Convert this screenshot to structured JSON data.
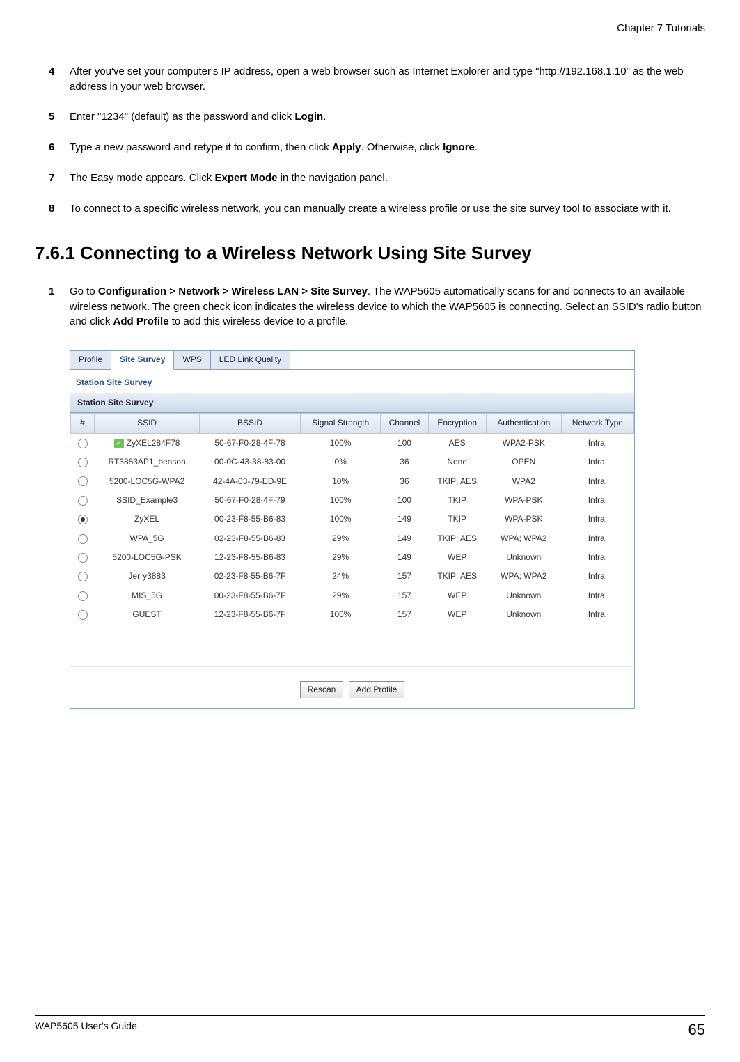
{
  "header_right": "Chapter 7 Tutorials",
  "steps_a": [
    {
      "num": "4",
      "html": "After you've set your computer's IP address, open a web browser such as Internet Explorer and type \"http://192.168.1.10\" as the web address in your web browser."
    },
    {
      "num": "5",
      "html": "Enter \"1234\" (default) as the password and click <b>Login</b>."
    },
    {
      "num": "6",
      "html": "Type a new password and retype it to confirm, then click <b>Apply</b>. Otherwise, click <b>Ignore</b>."
    },
    {
      "num": "7",
      "html": "The Easy mode appears. Click <b>Expert Mode</b> in the navigation panel."
    },
    {
      "num": "8",
      "html": "To connect to a specific wireless network, you can manually create a wireless profile or use the site survey tool to associate with it."
    }
  ],
  "section_heading": "7.6.1  Connecting to a Wireless Network Using Site Survey",
  "steps_b": [
    {
      "num": "1",
      "html": "Go to <b>Configuration > Network > Wireless LAN > Site Survey</b>. The WAP5605 automatically scans for and connects to an available wireless network. The green check icon indicates the wireless device to which the WAP5605 is connecting. Select an SSID's radio button and click <b>Add Profile</b> to add this wireless device to a profile."
    }
  ],
  "ui": {
    "tabs": [
      "Profile",
      "Site Survey",
      "WPS",
      "LED Link Quality"
    ],
    "active_tab_index": 1,
    "section_title": "Station Site Survey",
    "panel_head": "Station Site Survey",
    "columns": [
      "#",
      "SSID",
      "BSSID",
      "Signal Strength",
      "Channel",
      "Encryption",
      "Authentication",
      "Network Type"
    ],
    "rows": [
      {
        "selected": false,
        "connected": true,
        "ssid": "ZyXEL284F78",
        "bssid": "50-67-F0-28-4F-78",
        "signal": "100%",
        "channel": "100",
        "enc": "AES",
        "auth": "WPA2-PSK",
        "ntype": "Infra."
      },
      {
        "selected": false,
        "connected": false,
        "ssid": "RT3883AP1_benson",
        "bssid": "00-0C-43-38-83-00",
        "signal": "0%",
        "channel": "36",
        "enc": "None",
        "auth": "OPEN",
        "ntype": "Infra."
      },
      {
        "selected": false,
        "connected": false,
        "ssid": "5200-LOC5G-WPA2",
        "bssid": "42-4A-03-79-ED-9E",
        "signal": "10%",
        "channel": "36",
        "enc": "TKIP; AES",
        "auth": "WPA2",
        "ntype": "Infra."
      },
      {
        "selected": false,
        "connected": false,
        "ssid": "SSID_Example3",
        "bssid": "50-67-F0-28-4F-79",
        "signal": "100%",
        "channel": "100",
        "enc": "TKIP",
        "auth": "WPA-PSK",
        "ntype": "Infra."
      },
      {
        "selected": true,
        "connected": false,
        "ssid": "ZyXEL",
        "bssid": "00-23-F8-55-B6-83",
        "signal": "100%",
        "channel": "149",
        "enc": "TKIP",
        "auth": "WPA-PSK",
        "ntype": "Infra."
      },
      {
        "selected": false,
        "connected": false,
        "ssid": "WPA_5G",
        "bssid": "02-23-F8-55-B6-83",
        "signal": "29%",
        "channel": "149",
        "enc": "TKIP; AES",
        "auth": "WPA; WPA2",
        "ntype": "Infra."
      },
      {
        "selected": false,
        "connected": false,
        "ssid": "5200-LOC5G-PSK",
        "bssid": "12-23-F8-55-B6-83",
        "signal": "29%",
        "channel": "149",
        "enc": "WEP",
        "auth": "Unknown",
        "ntype": "Infra."
      },
      {
        "selected": false,
        "connected": false,
        "ssid": "Jerry3883",
        "bssid": "02-23-F8-55-B6-7F",
        "signal": "24%",
        "channel": "157",
        "enc": "TKIP; AES",
        "auth": "WPA; WPA2",
        "ntype": "Infra."
      },
      {
        "selected": false,
        "connected": false,
        "ssid": "MIS_5G",
        "bssid": "00-23-F8-55-B6-7F",
        "signal": "29%",
        "channel": "157",
        "enc": "WEP",
        "auth": "Unknown",
        "ntype": "Infra."
      },
      {
        "selected": false,
        "connected": false,
        "ssid": "GUEST",
        "bssid": "12-23-F8-55-B6-7F",
        "signal": "100%",
        "channel": "157",
        "enc": "WEP",
        "auth": "Unknown",
        "ntype": "Infra."
      }
    ],
    "buttons": {
      "rescan": "Rescan",
      "add_profile": "Add Profile"
    }
  },
  "footer": {
    "left": "WAP5605 User's Guide",
    "right": "65"
  }
}
